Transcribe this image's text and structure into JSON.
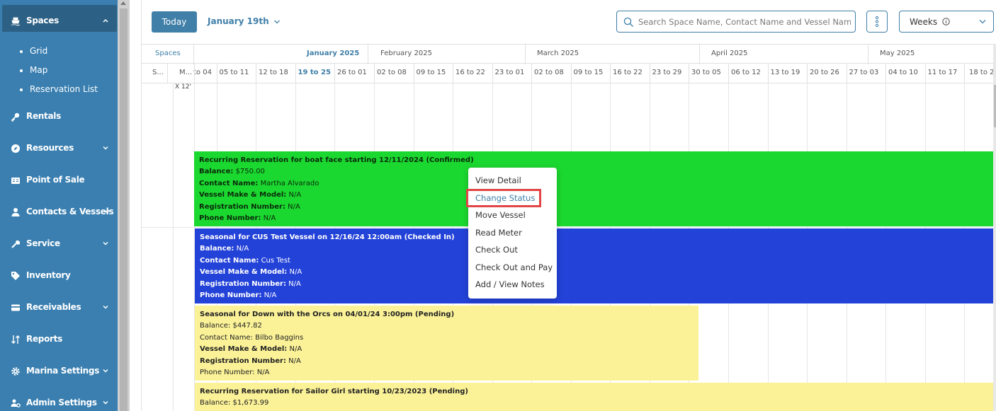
{
  "sidebar": {
    "items": [
      {
        "label": "Spaces",
        "icon": "ship-icon",
        "expanded": true
      },
      {
        "label": "Rentals",
        "icon": "key-icon"
      },
      {
        "label": "Resources",
        "icon": "compass-icon"
      },
      {
        "label": "Point of Sale",
        "icon": "register-icon"
      },
      {
        "label": "Contacts & Vessels",
        "icon": "user-icon"
      },
      {
        "label": "Service",
        "icon": "wrench-icon"
      },
      {
        "label": "Inventory",
        "icon": "tag-icon"
      },
      {
        "label": "Receivables",
        "icon": "card-icon"
      },
      {
        "label": "Reports",
        "icon": "sort-icon"
      },
      {
        "label": "Marina Settings",
        "icon": "gear-icon"
      },
      {
        "label": "Admin Settings",
        "icon": "users-gear-icon"
      }
    ],
    "subitems": [
      "Grid",
      "Map",
      "Reservation List"
    ]
  },
  "toolbar": {
    "today_label": "Today",
    "date_label": "January 19th",
    "search_placeholder": "Search Space Name, Contact Name and Vessel Name",
    "view_label": "Weeks"
  },
  "calendar": {
    "spaces_header": "Spaces",
    "months": [
      "January 2025",
      "February 2025",
      "March 2025",
      "April 2025",
      "May 2025"
    ],
    "current_month": "January 2025",
    "left_cols": [
      "S...",
      "M..."
    ],
    "weeks": [
      "to 04",
      "05 to 11",
      "12 to 18",
      "19 to 25",
      "26 to 01",
      "02 to 08",
      "09 to 15",
      "16 to 22",
      "23 to 01",
      "02 to 08",
      "09 to 15",
      "16 to 22",
      "23 to 29",
      "30 to 05",
      "06 to 12",
      "13 to 19",
      "20 to 26",
      "27 to 03",
      "04 to 10",
      "11 to 17",
      "18 to 2"
    ],
    "current_week": "19 to 25",
    "size_label": "X 12'"
  },
  "reservations": [
    {
      "title": "Recurring Reservation for boat face starting 12/11/2024 (Confirmed)",
      "status": "confirmed",
      "color": "#1bd830",
      "balance": "$750.00",
      "contact": "Martha Alvarado",
      "vessel": "N/A",
      "registration": "N/A",
      "phone": "N/A"
    },
    {
      "title": "Seasonal for CUS Test Vessel on 12/16/24 12:00am (Checked In)",
      "status": "checked-in",
      "color": "#2342d8",
      "balance": "N/A",
      "contact": "Cus Test",
      "vessel": "N/A",
      "registration": "N/A",
      "phone": "N/A"
    },
    {
      "title": "Seasonal for Down with the Orcs on 04/01/24 3:00pm (Pending)",
      "status": "pending",
      "color": "#fbf298",
      "balance": "$447.82",
      "contact": "Bilbo Baggins",
      "vessel": "N/A",
      "registration": "N/A",
      "phone": "N/A"
    },
    {
      "title": "Recurring Reservation for Sailor Girl starting 10/23/2023 (Pending)",
      "status": "pending",
      "color": "#fbf298",
      "balance": "$1,673.99"
    }
  ],
  "field_labels": {
    "balance": "Balance:",
    "contact": "Contact Name:",
    "vessel": "Vessel Make & Model:",
    "registration": "Registration Number:",
    "phone": "Phone Number:"
  },
  "context_menu": {
    "items": [
      "View Detail",
      "Change Status",
      "Move Vessel",
      "Read Meter",
      "Check Out",
      "Check Out and Pay",
      "Add / View Notes"
    ],
    "highlighted": "Change Status"
  },
  "colors": {
    "sidebar": "#3a7fb0",
    "sidebar_active": "#2c6185",
    "accent": "#3f7fa8",
    "highlight_box": "#e14545"
  }
}
